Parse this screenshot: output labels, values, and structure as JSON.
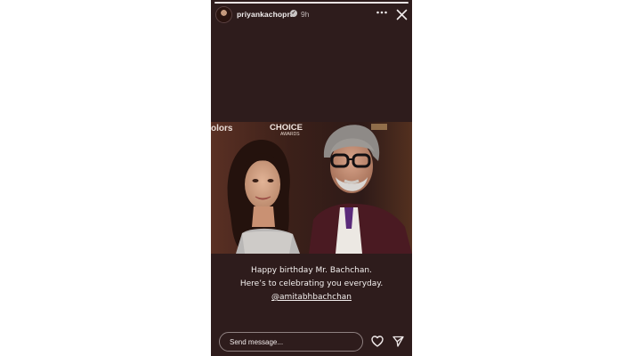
{
  "story": {
    "progress": 1.0,
    "header": {
      "username": "priyankachopra",
      "verified_icon": "verified-badge-icon",
      "time": "9h",
      "more_icon": "more-horizontal-icon",
      "close_icon": "close-icon"
    },
    "photo": {
      "backdrop_text_left": "olors",
      "backdrop_text_mid": "CHOICE",
      "backdrop_text_mid2": "AWARDS"
    },
    "caption": {
      "line1": "Happy birthday Mr. Bachchan.",
      "line2": "Here’s to celebrating you everyday.",
      "mention": "@amitabhbachchan"
    },
    "footer": {
      "placeholder": "Send message...",
      "like_icon": "heart-icon",
      "share_icon": "send-icon"
    }
  },
  "colors": {
    "story_background": "#2e1c1c",
    "text": "#f4f0ef"
  }
}
